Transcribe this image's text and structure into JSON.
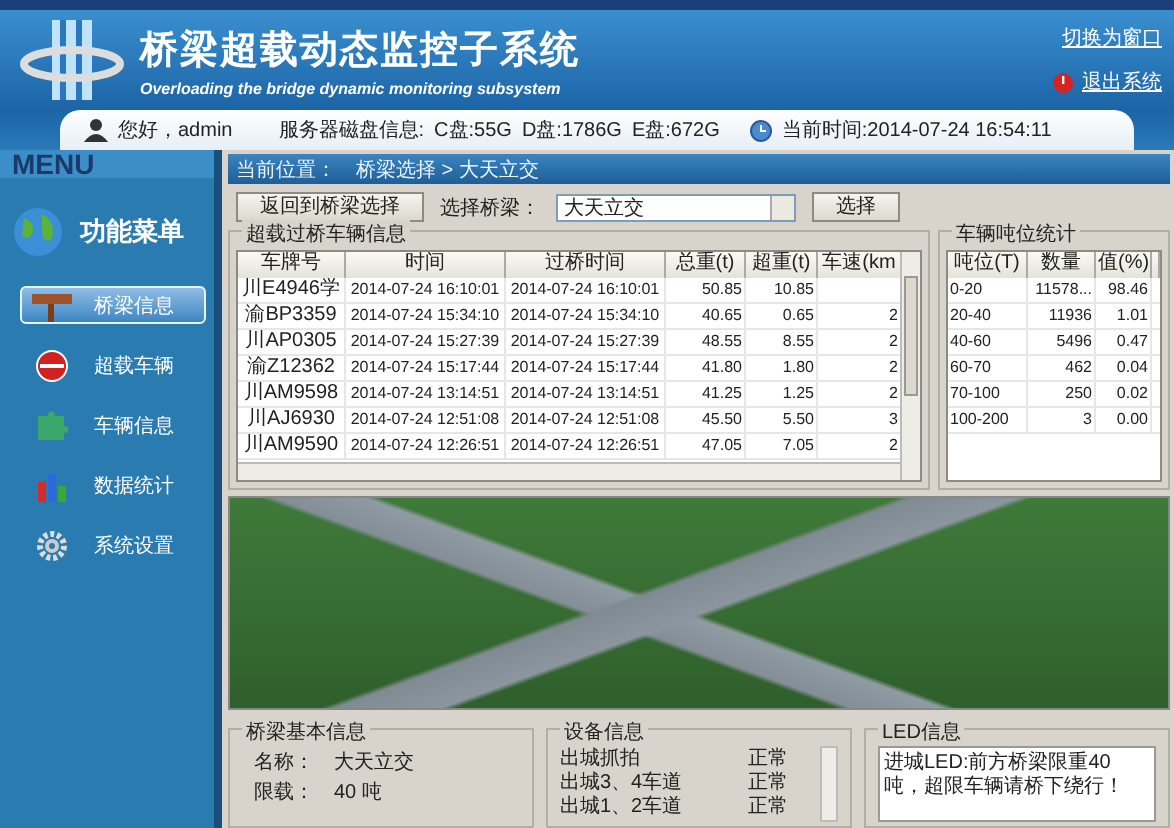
{
  "header": {
    "title": "桥梁超载动态监控子系统",
    "subtitle": "Overloading the bridge dynamic monitoring subsystem",
    "links": [
      {
        "label": "切换为窗口",
        "kind": "plain"
      },
      {
        "label": "退出系统",
        "kind": "exit"
      }
    ]
  },
  "user_bar": {
    "greeting": "您好，admin",
    "disk_label": "服务器磁盘信息:",
    "disks": [
      "C盘:55G",
      "D盘:1786G",
      "E盘:672G"
    ],
    "time": "当前时间:2014-07-24 16:54:11"
  },
  "sidebar": {
    "menu_label": "MENU",
    "heading": "功能菜单",
    "items": [
      {
        "label": "桥梁信息",
        "kind": "signpost",
        "selected": true
      },
      {
        "label": "超载车辆",
        "kind": "stop",
        "selected": false
      },
      {
        "label": "车辆信息",
        "kind": "puzzle",
        "selected": false
      },
      {
        "label": "数据统计",
        "kind": "chart",
        "selected": false
      },
      {
        "label": "系统设置",
        "kind": "gear",
        "selected": false
      }
    ]
  },
  "breadcrumb": {
    "label": "当前位置：",
    "path": "桥梁选择 > 大天立交"
  },
  "toolbar": {
    "back_button": "返回到桥梁选择",
    "select_label": "选择桥梁：",
    "bridge": "大天立交",
    "select_button": "选择"
  },
  "vehicles": {
    "title": "超载过桥车辆信息",
    "columns": [
      "车牌号",
      "时间",
      "过桥时间",
      "总重(t)",
      "超重(t)",
      "车速(km"
    ],
    "rows": [
      [
        "川E4946学",
        "2014-07-24 16:10:01",
        "2014-07-24 16:10:01",
        "50.85",
        "10.85",
        ""
      ],
      [
        "渝BP3359",
        "2014-07-24 15:34:10",
        "2014-07-24 15:34:10",
        "40.65",
        "0.65",
        "2"
      ],
      [
        "川AP0305",
        "2014-07-24 15:27:39",
        "2014-07-24 15:27:39",
        "48.55",
        "8.55",
        "2"
      ],
      [
        "渝Z12362",
        "2014-07-24 15:17:44",
        "2014-07-24 15:17:44",
        "41.80",
        "1.80",
        "2"
      ],
      [
        "川AM9598",
        "2014-07-24 13:14:51",
        "2014-07-24 13:14:51",
        "41.25",
        "1.25",
        "2"
      ],
      [
        "川AJ6930",
        "2014-07-24 12:51:08",
        "2014-07-24 12:51:08",
        "45.50",
        "5.50",
        "3"
      ],
      [
        "川AM9590",
        "2014-07-24 12:26:51",
        "2014-07-24 12:26:51",
        "47.05",
        "7.05",
        "2"
      ]
    ]
  },
  "weight_stats": {
    "title": "车辆吨位统计",
    "columns": [
      "吨位(T)",
      "数量",
      "值(%)"
    ],
    "rows": [
      [
        "0-20",
        "11578...",
        "98.46"
      ],
      [
        "20-40",
        "11936",
        "1.01"
      ],
      [
        "40-60",
        "5496",
        "0.47"
      ],
      [
        "60-70",
        "462",
        "0.04"
      ],
      [
        "70-100",
        "250",
        "0.02"
      ],
      [
        "100-200",
        "3",
        "0.00"
      ]
    ]
  },
  "bridge_info": {
    "title": "桥梁基本信息",
    "fields": [
      {
        "label": "名称：",
        "value": "大天立交"
      },
      {
        "label": "限载：",
        "value": "40 吨"
      }
    ]
  },
  "devices": {
    "title": "设备信息",
    "rows": [
      {
        "name": "出城抓拍",
        "status": "正常"
      },
      {
        "name": "出城3、4车道",
        "status": "正常"
      },
      {
        "name": "出城1、2车道",
        "status": "正常"
      }
    ]
  },
  "led": {
    "title": "LED信息",
    "text": "进城LED:前方桥梁限重40吨，超限车辆请桥下绕行！"
  }
}
